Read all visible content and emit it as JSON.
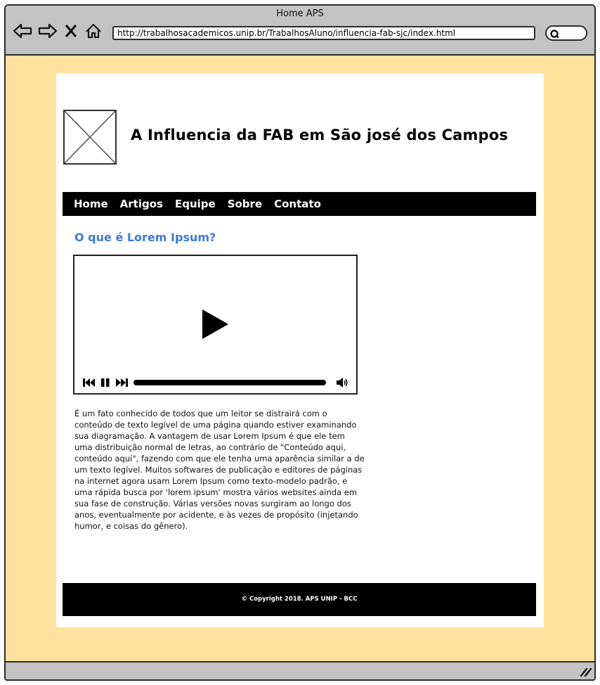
{
  "window": {
    "title": "Home APS"
  },
  "browser": {
    "url": "http://trabalhosacademicos.unip.br/TrabalhosAluno/influencia-fab-sjc/index.html",
    "icons": [
      "back-arrow-icon",
      "forward-arrow-icon",
      "close-icon",
      "home-icon",
      "search-icon",
      "resize-grip-icon"
    ]
  },
  "site": {
    "title": "A Influencia da FAB em São josé dos Campos",
    "logo": "image-placeholder-icon"
  },
  "nav": {
    "items": [
      {
        "label": "Home"
      },
      {
        "label": "Artigos"
      },
      {
        "label": "Equipe"
      },
      {
        "label": "Sobre"
      },
      {
        "label": "Contato"
      }
    ]
  },
  "content": {
    "heading": "O que é Lorem Ipsum?",
    "paragraph": "É um fato conhecido de todos que um leitor se distrairá com o conteúdo de texto legível de uma página quando estiver examinando sua diagramação. A vantagem de usar Lorem Ipsum é que ele tem uma distribuição normal de letras, ao contrário de \"Conteúdo aqui, conteúdo aqui\", fazendo com que ele tenha uma aparência similar a de um texto legível. Muitos softwares de publicação e editores de páginas na internet agora usam Lorem Ipsum como texto-modelo padrão, e uma rápida busca por 'lorem ipsum' mostra vários websites ainda em sua fase de construção. Várias versões novas surgiram ao longo dos anos, eventualmente por acidente, e às vezes de propósito (injetando humor, e coisas do gênero)."
  },
  "video": {
    "controls": [
      "previous-icon",
      "pause-icon",
      "next-icon",
      "volume-icon"
    ]
  },
  "footer": {
    "text": "© Copyright 2018. APS UNIP - BCC"
  },
  "colors": {
    "page_background": "#ffe29e",
    "chrome": "#c3c3c3",
    "heading_accent": "#3d7bd6",
    "nav_background": "#000000"
  }
}
